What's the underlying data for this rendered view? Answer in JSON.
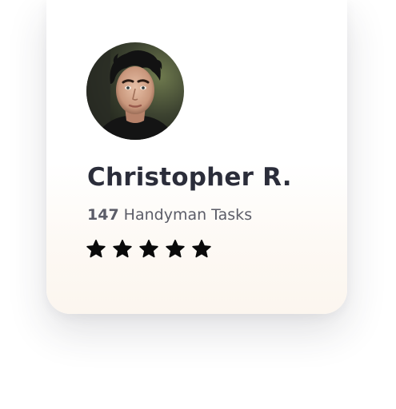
{
  "profile": {
    "name": "Christopher R.",
    "task_count": "147",
    "task_label": "Handyman Tasks",
    "rating": 5,
    "rating_max": 5
  },
  "colors": {
    "name_text": "#2b2d3a",
    "secondary_text": "#5c5d68",
    "star": "#0a0a0a",
    "card_bottom": "#fcf6ef"
  },
  "icons": {
    "avatar": "avatar-photo",
    "star": "star-icon"
  }
}
